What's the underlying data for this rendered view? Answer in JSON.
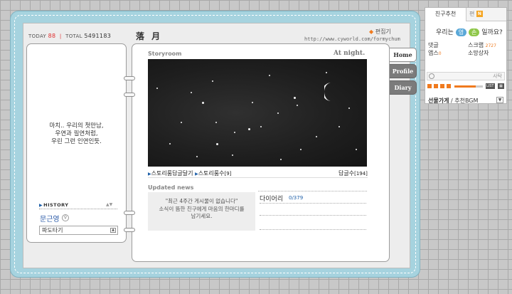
{
  "header": {
    "today_label": "TODAY",
    "today_value": "88",
    "total_label": "TOTAL",
    "total_value": "5491183",
    "site_title": "落 月",
    "edit_link": "편집기",
    "url": "http://www.cyworld.com/formychum"
  },
  "left": {
    "quote_lines": [
      "마치.. 우리의 첫만남,",
      "우연과 필연처럼,",
      "우린 그런 인연인듯."
    ],
    "history_label": "HISTORY",
    "owner_name": "문근영",
    "owner_gender_symbol": "♀",
    "select_value": "파도타기"
  },
  "main": {
    "storyroom_title": "Storyroom",
    "photo_title": "At night.",
    "link_reply": "스토리룸답글달기",
    "link_count_label": "스토리룸수",
    "link_count_value": "[9]",
    "comment_label": "답글수",
    "comment_value": "[194]",
    "updated_title": "Updated news",
    "updated_lines": [
      "\"최근 4주간 게시물이 없습니다\"",
      "소식이 뜸한 친구에게 마음의 한마디를",
      "남기세요."
    ],
    "diary_label": "다이어리",
    "diary_count": "0/379"
  },
  "tabs": [
    "Home",
    "Profile",
    "Diary"
  ],
  "widget": {
    "tab1": "친구추천",
    "tab2": "편",
    "tab2_badge": "N",
    "question_before": "우리는",
    "yes": "영",
    "no": "손",
    "question_after": "일까요?",
    "stats": [
      {
        "label": "댓글",
        "num": ""
      },
      {
        "label": "스크랩",
        "num": "2727"
      },
      {
        "label": "앱스",
        "num": "0"
      },
      {
        "label": "소망상자",
        "num": ""
      }
    ],
    "player_text": "사탁",
    "list_label": "LIST",
    "bgm_bold": "선물가게",
    "bgm_rest": "/ 추천BGM"
  },
  "colors": {
    "book_blue": "#a6d3df",
    "accent_orange": "#f07a1e",
    "link_blue": "#2a5aa7",
    "counter_red": "#e03030"
  }
}
